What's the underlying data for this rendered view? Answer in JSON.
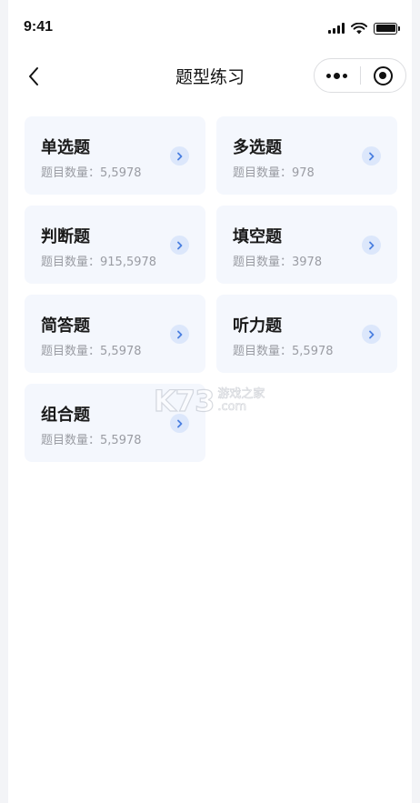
{
  "status_bar": {
    "time": "9:41"
  },
  "nav": {
    "title": "题型练习"
  },
  "cards": [
    {
      "title": "单选题",
      "count_label": "题目数量：",
      "count": "5,5978"
    },
    {
      "title": "多选题",
      "count_label": "题目数量：",
      "count": "978"
    },
    {
      "title": "判断题",
      "count_label": "题目数量：",
      "count": "915,5978"
    },
    {
      "title": "填空题",
      "count_label": "题目数量：",
      "count": "3978"
    },
    {
      "title": "简答题",
      "count_label": "题目数量：",
      "count": "5,5978"
    },
    {
      "title": "听力题",
      "count_label": "题目数量：",
      "count": "5,5978"
    },
    {
      "title": "组合题",
      "count_label": "题目数量：",
      "count": "5,5978"
    }
  ],
  "watermark": {
    "logo": "K73",
    "cn": "游戏之家",
    "domain": ".com"
  },
  "colors": {
    "card_bg": "#f4f7fd",
    "arrow_bg": "#dce7fb",
    "arrow": "#4a7fe0"
  },
  "icons": {
    "back": "chevron-left-icon",
    "more": "more-dots-icon",
    "close": "target-circle-icon",
    "card_arrow": "chevron-right-icon"
  }
}
